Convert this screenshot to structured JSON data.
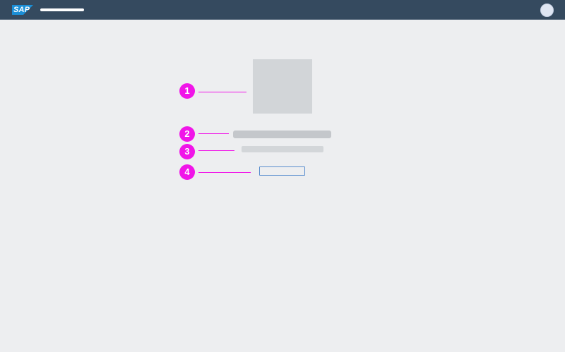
{
  "shell": {
    "logo_text": "SAP",
    "app_title": "",
    "colors": {
      "shell_bg": "#354a5f",
      "page_bg": "#edeef0",
      "marker": "#f015e8",
      "button_border": "#5b8fcf"
    }
  },
  "empty_state": {
    "illustration_icon": "illustration-placeholder",
    "title": "",
    "description": "",
    "action_label": ""
  },
  "markers": [
    {
      "number": "1"
    },
    {
      "number": "2"
    },
    {
      "number": "3"
    },
    {
      "number": "4"
    }
  ]
}
